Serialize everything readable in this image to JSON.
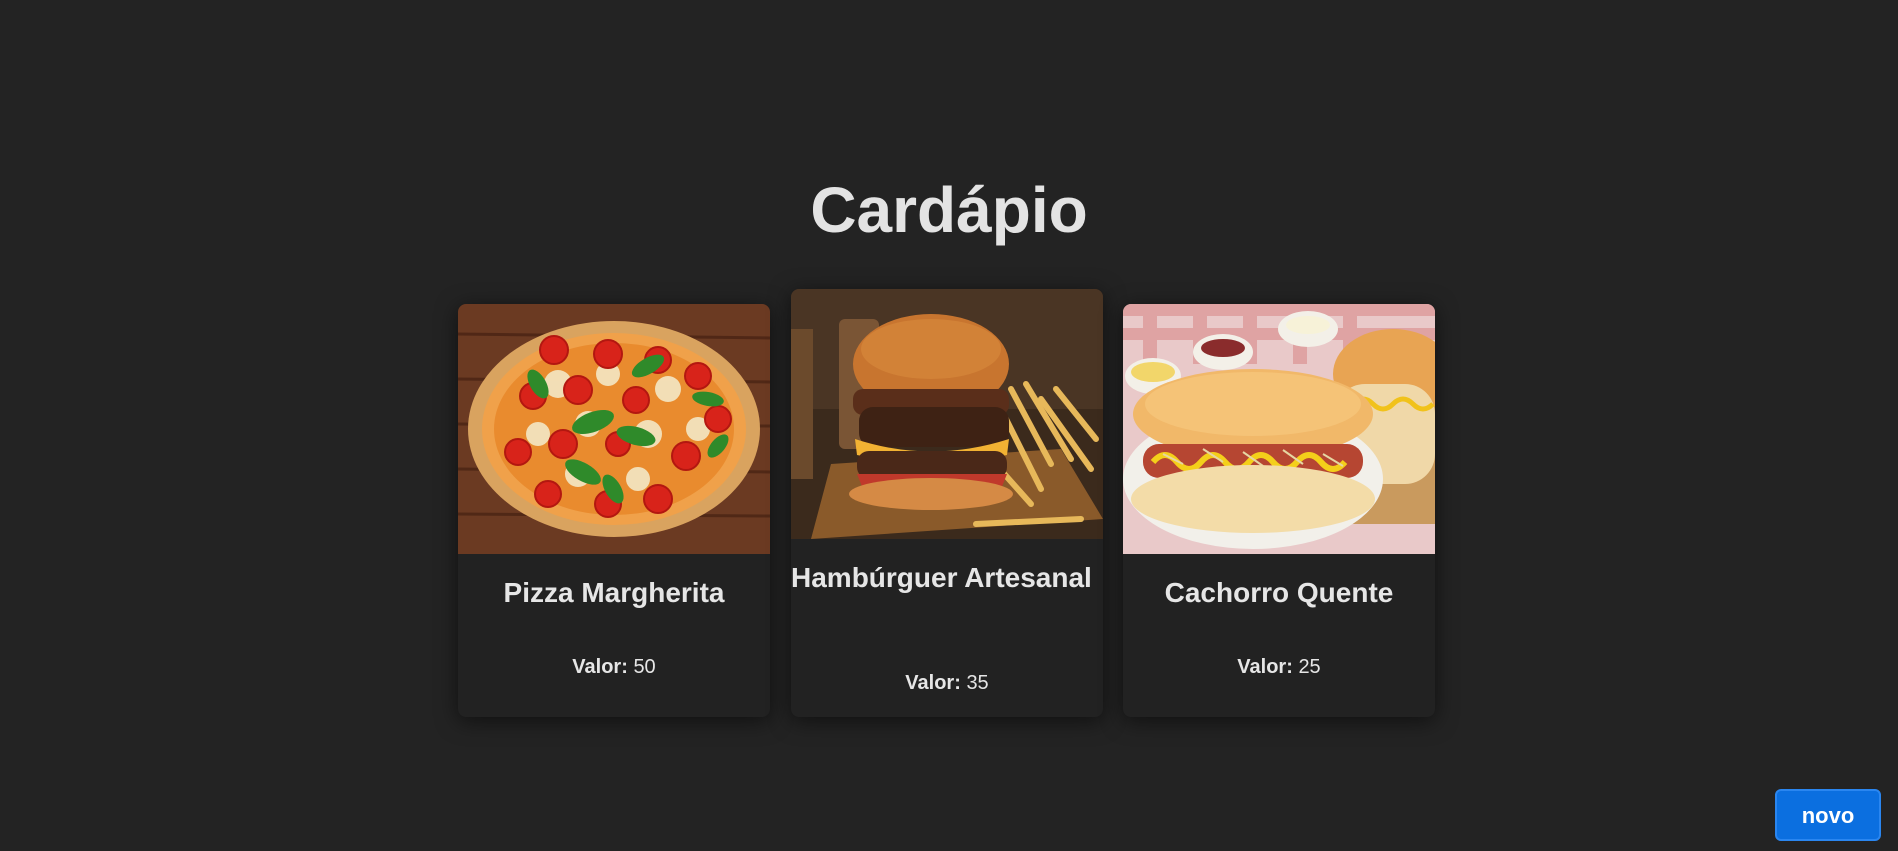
{
  "page": {
    "title": "Cardápio"
  },
  "menu": {
    "items": [
      {
        "name": "Pizza Margherita",
        "price_label": "Valor:",
        "price_value": "50",
        "image": "pizza-margherita-photo"
      },
      {
        "name": "Hambúrguer Artesanal",
        "price_label": "Valor:",
        "price_value": "35",
        "image": "burger-fries-photo"
      },
      {
        "name": "Cachorro Quente",
        "price_label": "Valor:",
        "price_value": "25",
        "image": "hot-dog-photo"
      }
    ]
  },
  "actions": {
    "new_label": "novo"
  },
  "colors": {
    "background": "#232323",
    "card": "#222222",
    "text": "#e6e6e6",
    "button": "#0b6fe0"
  }
}
